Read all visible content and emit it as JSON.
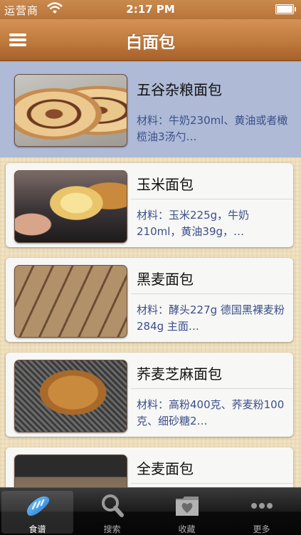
{
  "status_bar": {
    "carrier": "运营商",
    "time": "2:17 PM"
  },
  "nav": {
    "title": "白面包"
  },
  "recipes": [
    {
      "title": "五谷杂粮面包",
      "desc": "材料：牛奶230ml、黄油或者橄榄油3汤勺…",
      "selected": true
    },
    {
      "title": "玉米面包",
      "desc": "材料：玉米225g，牛奶210ml，黄油39g，…"
    },
    {
      "title": "黑麦面包",
      "desc": "材料：酵头227g 德国黑裸麦粉284g 主面…"
    },
    {
      "title": "荞麦芝麻面包",
      "desc": "材料：高粉400克、荞麦粉100克、细砂糖2…"
    },
    {
      "title": "全麦面包",
      "desc": ""
    }
  ],
  "tabs": [
    {
      "label": "食谱",
      "icon": "bread-icon",
      "active": true
    },
    {
      "label": "搜索",
      "icon": "search-icon"
    },
    {
      "label": "收藏",
      "icon": "favorites-icon"
    },
    {
      "label": "更多",
      "icon": "more-icon"
    }
  ],
  "colors": {
    "nav": "#c07b3e",
    "selected_row": "#aebad6",
    "desc_text": "#3b4f8a"
  }
}
